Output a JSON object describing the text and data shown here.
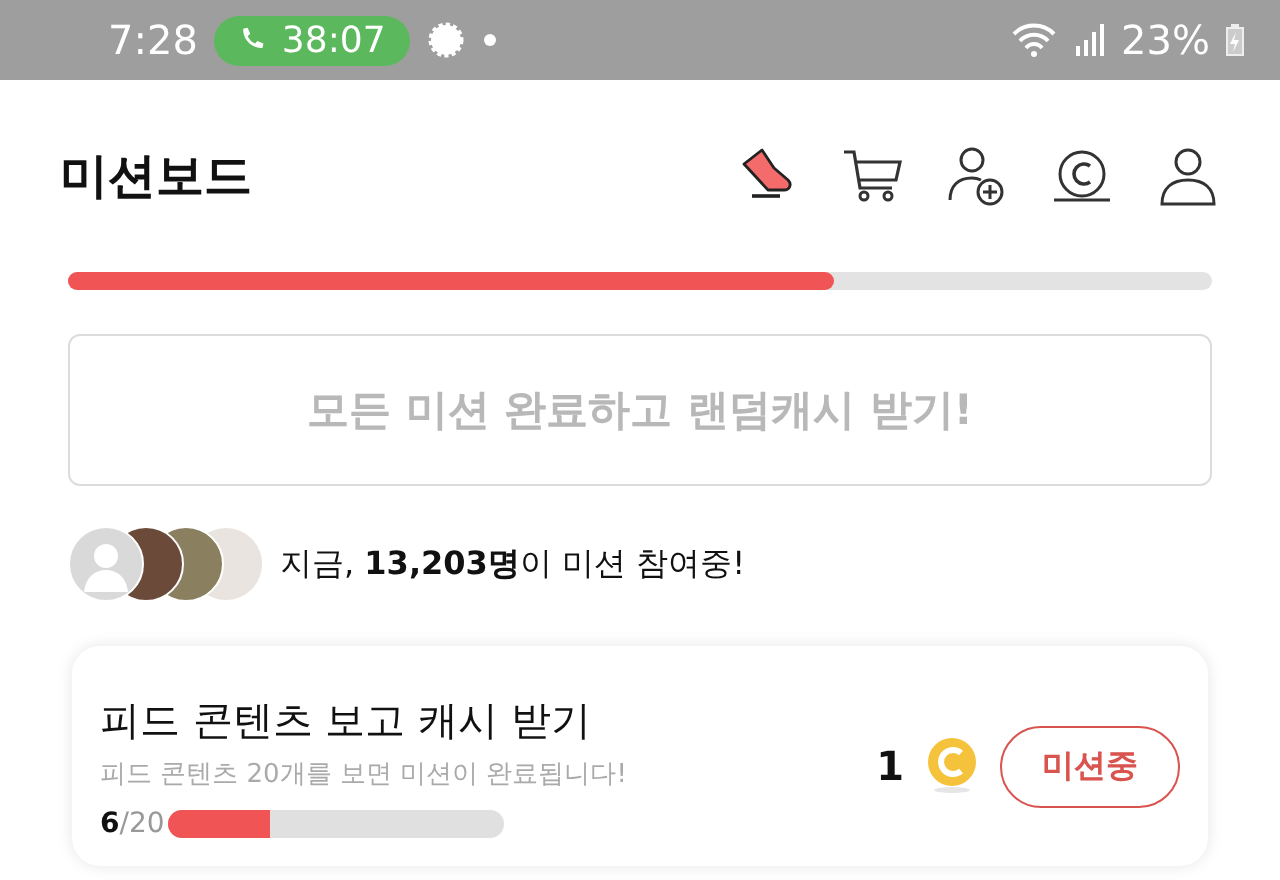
{
  "status_bar": {
    "time": "7:28",
    "call_timer": "38:07",
    "battery": "23%"
  },
  "header": {
    "title": "미션보드"
  },
  "overall_progress": {
    "level": 0.67
  },
  "reward_banner": {
    "text": "모든 미션 완료하고 랜덤캐시 받기!"
  },
  "participants": {
    "text": "지금, **13,203명**이 미션 참여중!"
  },
  "missions": [
    {
      "title": "피드 콘텐츠 보고 캐시 받기",
      "description": "피드 콘텐츠 20개를 보면 미션이 완료됩니다!",
      "progress_text": "**6**/20",
      "level": 0.3,
      "reward": "1",
      "button": "미션중"
    }
  ]
}
